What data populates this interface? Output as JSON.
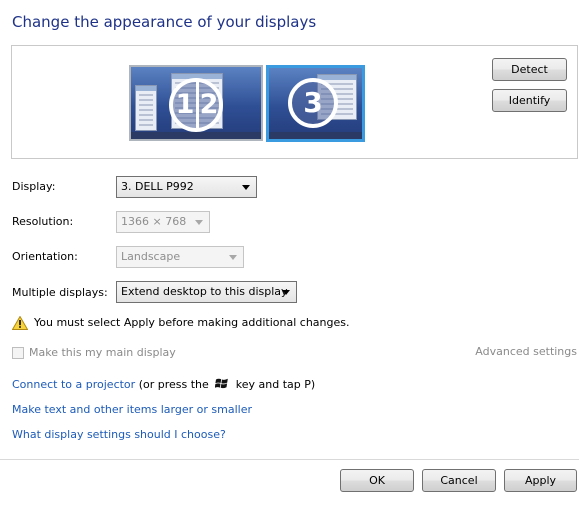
{
  "title": "Change the appearance of your displays",
  "preview": {
    "monitor_group_label_1": "1",
    "monitor_group_label_2": "2",
    "monitor_selected_label": "3",
    "detect_label": "Detect",
    "identify_label": "Identify"
  },
  "settings": {
    "display_label": "Display:",
    "display_value": "3. DELL P992",
    "resolution_label": "Resolution:",
    "resolution_value": "1366 × 768",
    "orientation_label": "Orientation:",
    "orientation_value": "Landscape",
    "multiple_label": "Multiple displays:",
    "multiple_value": "Extend desktop to this display"
  },
  "warning": {
    "icon": "warning-icon",
    "text": "You must select Apply before making additional changes."
  },
  "main_display": {
    "checkbox_label": "Make this my main display",
    "checked": false,
    "advanced_label": "Advanced settings"
  },
  "links": {
    "projector_link": "Connect to a projector",
    "projector_suffix_before": "(or press the",
    "projector_icon": "windows-logo-icon",
    "projector_suffix_after": "key and tap P)",
    "text_size_link": "Make text and other items larger or smaller",
    "help_link": "What display settings should I choose?"
  },
  "footer": {
    "ok_label": "OK",
    "cancel_label": "Cancel",
    "apply_label": "Apply"
  },
  "colors": {
    "title": "#1e3287",
    "link": "#1c5bb8",
    "selection_border": "#3a9be0"
  }
}
